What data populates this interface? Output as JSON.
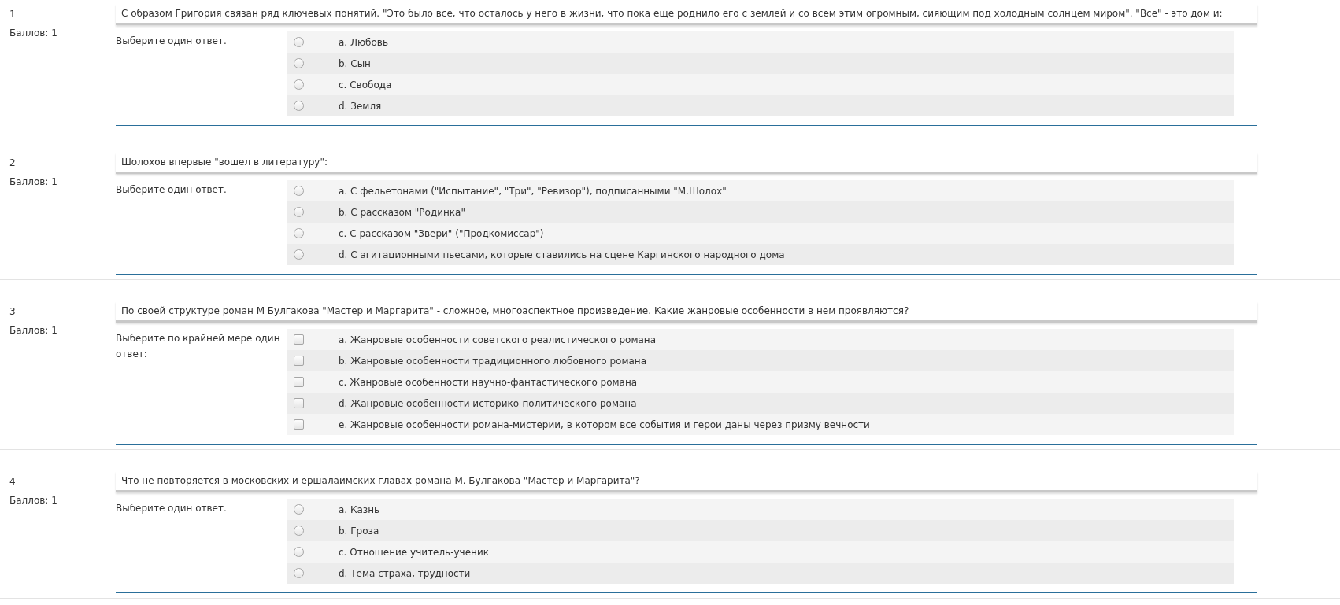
{
  "questions": [
    {
      "number": "1",
      "points": "Баллов: 1",
      "text": "С образом Григория связан ряд ключевых понятий. \"Это было все, что осталось у него в жизни, что пока еще роднило его с землей и со всем этим огромным, сияющим под холодным солнцем миром\". \"Все\" - это дом и:",
      "prompt": "Выберите один ответ.",
      "kind": "radio",
      "options": [
        {
          "label": "a. Любовь",
          "checked": false
        },
        {
          "label": "b. Сын",
          "checked": false
        },
        {
          "label": "c. Свобода",
          "checked": false
        },
        {
          "label": "d. Земля",
          "checked": false
        }
      ]
    },
    {
      "number": "2",
      "points": "Баллов: 1",
      "text": "Шолохов впервые \"вошел в литературу\":",
      "prompt": "Выберите один ответ.",
      "kind": "radio",
      "options": [
        {
          "label": "a. С фельетонами (\"Испытание\", \"Три\", \"Ревизор\"), подписанными \"М.Шолох\"",
          "checked": false
        },
        {
          "label": "b. С рассказом \"Родинка\"",
          "checked": false
        },
        {
          "label": "c. С рассказом \"Звери\" (\"Продкомиссар\")",
          "checked": false
        },
        {
          "label": "d. С агитационными пьесами, которые ставились на сцене Каргинского народного дома",
          "checked": false
        }
      ]
    },
    {
      "number": "3",
      "points": "Баллов: 1",
      "text": "По своей структуре роман М Булгакова \"Мастер и Маргарита\" - сложное, многоаспектное произведение. Какие жанровые особенности в нем проявляются?",
      "prompt": "Выберите по крайней мере один ответ:",
      "kind": "checkbox",
      "options": [
        {
          "label": "a. Жанровые особенности советского реалистического романа",
          "checked": false
        },
        {
          "label": "b. Жанровые особенности традиционного любовного романа",
          "checked": false
        },
        {
          "label": "c. Жанровые особенности научно-фантастического романа",
          "checked": false
        },
        {
          "label": "d. Жанровые особенности историко-политического романа",
          "checked": false
        },
        {
          "label": "e. Жанровые особенности романа-мистерии, в котором все события и герои даны через призму вечности",
          "checked": false
        }
      ]
    },
    {
      "number": "4",
      "points": "Баллов: 1",
      "text": "Что не повторяется в московских и ершалаимских главах романа М. Булгакова \"Мастер и Маргарита\"?",
      "prompt": "Выберите один ответ.",
      "kind": "radio",
      "options": [
        {
          "label": "a. Казнь",
          "checked": false
        },
        {
          "label": "b. Гроза",
          "checked": false
        },
        {
          "label": "c. Отношение учитель-ученик",
          "checked": false
        },
        {
          "label": "d. Тема страха, трудности",
          "checked": false
        }
      ]
    }
  ]
}
